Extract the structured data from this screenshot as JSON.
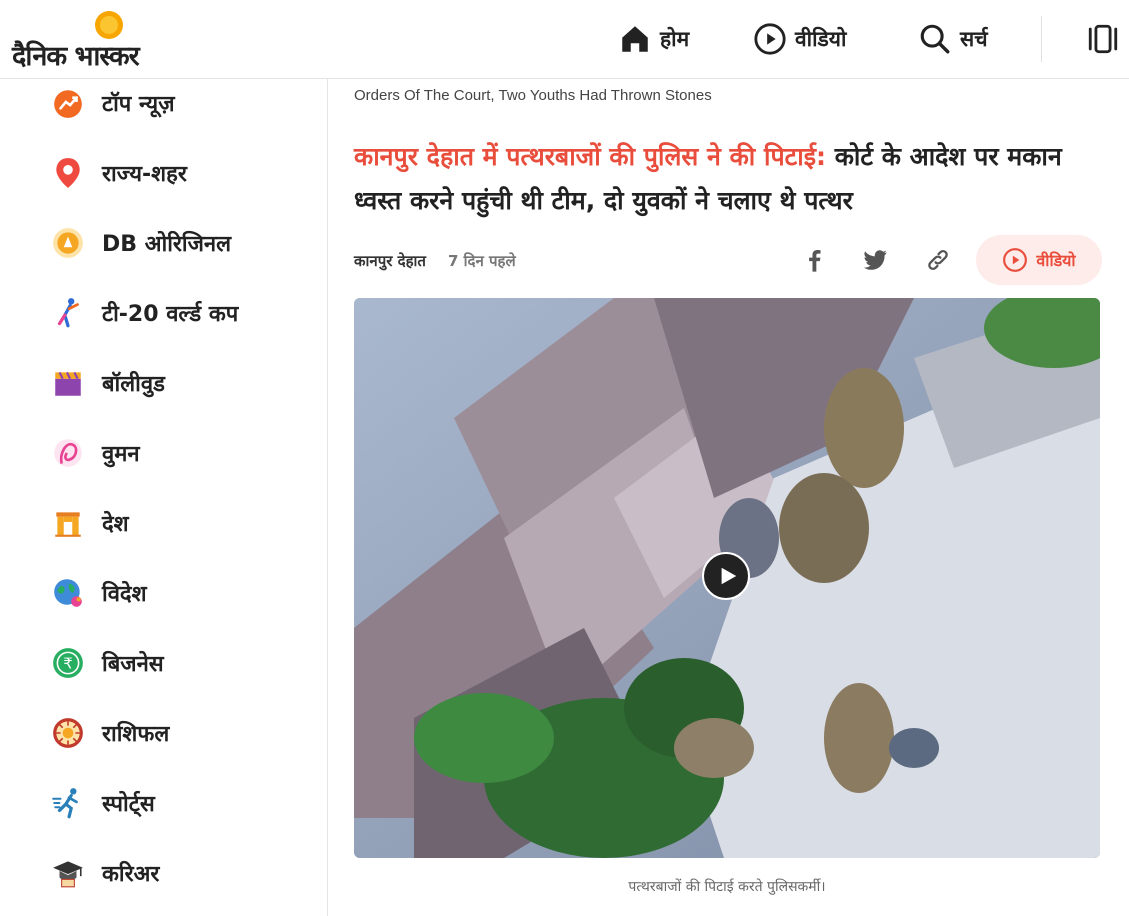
{
  "header": {
    "logo_text": "दैनिक भास्कर",
    "nav": [
      {
        "label": "होम",
        "icon": "home-icon"
      },
      {
        "label": "वीडियो",
        "icon": "play-circle-icon"
      },
      {
        "label": "सर्च",
        "icon": "search-icon"
      }
    ],
    "menu_icon": "sidebar-menu-icon"
  },
  "sidebar": {
    "items": [
      {
        "label": "टॉप न्यूज़",
        "icon": "fire-icon",
        "color": "#f26a21"
      },
      {
        "label": "राज्य-शहर",
        "icon": "location-pin-icon",
        "color": "#ef4a3f"
      },
      {
        "label": "DB ओरिजिनल",
        "icon": "db-original-icon",
        "color": "#f5a623"
      },
      {
        "label": "टी-20 वर्ल्ड कप",
        "icon": "cricket-icon",
        "color": "#2e6bd6"
      },
      {
        "label": "बॉलीवुड",
        "icon": "clapperboard-icon",
        "color": "#8e44ad"
      },
      {
        "label": "वुमन",
        "icon": "woman-icon",
        "color": "#e84393"
      },
      {
        "label": "देश",
        "icon": "india-gate-icon",
        "color": "#f5a623"
      },
      {
        "label": "विदेश",
        "icon": "globe-icon",
        "color": "#3d8bd9"
      },
      {
        "label": "बिजनेस",
        "icon": "rupee-icon",
        "color": "#27ae60"
      },
      {
        "label": "राशिफल",
        "icon": "zodiac-icon",
        "color": "#c0392b"
      },
      {
        "label": "स्पोर्ट्स",
        "icon": "runner-icon",
        "color": "#2980b9"
      },
      {
        "label": "करिअर",
        "icon": "graduation-cap-icon",
        "color": "#333333"
      }
    ]
  },
  "article": {
    "subtitle": "Orders Of The Court, Two Youths Had Thrown Stones",
    "headline_highlight": "कानपुर देहात में पत्थरबाजों की पुलिस ने की पिटाई:",
    "headline_rest": " कोर्ट के आदेश पर मकान ध्वस्त करने पहुंची थी टीम, दो युवकों ने चलाए थे पत्थर",
    "location": "कानपुर देहात",
    "time": "7 दिन पहले",
    "share_icons": [
      "facebook-icon",
      "twitter-icon",
      "link-icon"
    ],
    "video_button_label": "वीडियो",
    "video_caption": "पत्थरबाजों की पिटाई करते पुलिसकर्मी।",
    "accent_color": "#e94d3c"
  }
}
